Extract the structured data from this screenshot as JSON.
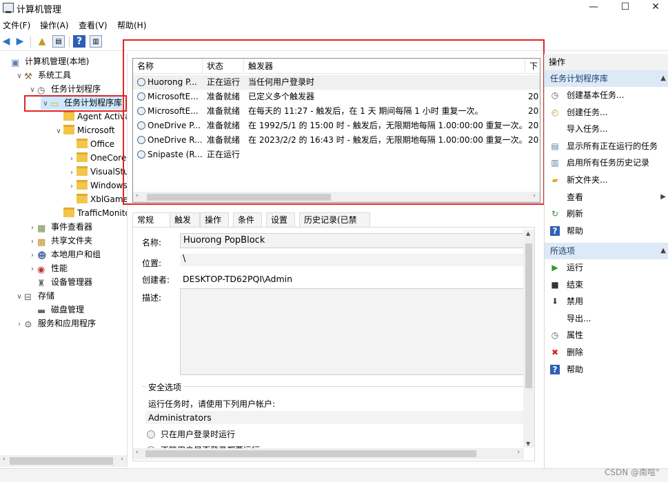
{
  "window": {
    "title": "计算机管理",
    "minimize": "—",
    "maximize": "☐",
    "close": "✕"
  },
  "menu": [
    "文件(F)",
    "操作(A)",
    "查看(V)",
    "帮助(H)"
  ],
  "tree": [
    {
      "label": "计算机管理(本地)",
      "level": 0,
      "chev": "",
      "icon": "computer-icon"
    },
    {
      "label": "系统工具",
      "level": 1,
      "chev": "∨",
      "icon": "tools-icon"
    },
    {
      "label": "任务计划程序",
      "level": 2,
      "chev": "∨",
      "icon": "clock-icon"
    },
    {
      "label": "任务计划程序库",
      "level": 3,
      "chev": "∨",
      "icon": "folder-clock-icon"
    },
    {
      "label": "Agent Activatio",
      "level": 4,
      "chev": "",
      "icon": "folder-icon"
    },
    {
      "label": "Microsoft",
      "level": 4,
      "chev": "∨",
      "icon": "folder-icon"
    },
    {
      "label": "Office",
      "level": 5,
      "chev": "",
      "icon": "folder-icon"
    },
    {
      "label": "OneCore",
      "level": 5,
      "chev": "›",
      "icon": "folder-icon"
    },
    {
      "label": "VisualStudio",
      "level": 5,
      "chev": "›",
      "icon": "folder-icon"
    },
    {
      "label": "Windows",
      "level": 5,
      "chev": "›",
      "icon": "folder-icon"
    },
    {
      "label": "XblGameSa",
      "level": 5,
      "chev": "",
      "icon": "folder-icon"
    },
    {
      "label": "TrafficMonitor",
      "level": 4,
      "chev": "",
      "icon": "folder-icon"
    },
    {
      "label": "事件查看器",
      "level": 2,
      "chev": "›",
      "icon": "event-viewer-icon"
    },
    {
      "label": "共享文件夹",
      "level": 2,
      "chev": "›",
      "icon": "shared-folder-icon"
    },
    {
      "label": "本地用户和组",
      "level": 2,
      "chev": "›",
      "icon": "users-icon"
    },
    {
      "label": "性能",
      "level": 2,
      "chev": "›",
      "icon": "performance-icon"
    },
    {
      "label": "设备管理器",
      "level": 2,
      "chev": "",
      "icon": "device-manager-icon"
    },
    {
      "label": "存储",
      "level": 1,
      "chev": "∨",
      "icon": "storage-icon"
    },
    {
      "label": "磁盘管理",
      "level": 2,
      "chev": "",
      "icon": "disk-icon"
    },
    {
      "label": "服务和应用程序",
      "level": 1,
      "chev": "›",
      "icon": "services-icon"
    }
  ],
  "list": {
    "headers": {
      "name": "名称",
      "status": "状态",
      "trigger": "触发器",
      "next": "下"
    },
    "rows": [
      {
        "name": "Huorong P...",
        "status": "正在运行",
        "trigger": "当任何用户登录时",
        "next": ""
      },
      {
        "name": "MicrosoftE...",
        "status": "准备就绪",
        "trigger": "已定义多个触发器",
        "next": "20"
      },
      {
        "name": "MicrosoftE...",
        "status": "准备就绪",
        "trigger": "在每天的 11:27 - 触发后，在 1 天 期间每隔 1 小时 重复一次。",
        "next": "20"
      },
      {
        "name": "OneDrive P...",
        "status": "准备就绪",
        "trigger": "在 1992/5/1 的 15:00 时 - 触发后，无限期地每隔 1.00:00:00 重复一次。",
        "next": "20"
      },
      {
        "name": "OneDrive R...",
        "status": "准备就绪",
        "trigger": "在 2023/2/2 的 16:43 时 - 触发后，无限期地每隔 1.00:00:00 重复一次。",
        "next": "20"
      },
      {
        "name": "Snipaste (R...",
        "status": "正在运行",
        "trigger": "",
        "next": ""
      }
    ]
  },
  "tabs": [
    "常规",
    "触发器",
    "操作",
    "条件",
    "设置",
    "历史记录(已禁用)"
  ],
  "general": {
    "name_label": "名称:",
    "name_value": "Huorong PopBlock",
    "location_label": "位置:",
    "location_value": "\\",
    "author_label": "创建者:",
    "author_value": "DESKTOP-TD62PQI\\Admin",
    "desc_label": "描述:",
    "security_title": "安全选项",
    "run_as_text": "运行任务时，请使用下列用户帐户:",
    "account": "Administrators",
    "radio1": "只在用户登录时运行",
    "radio2": "不管用户是否登录都要运行"
  },
  "actions": {
    "header": "操作",
    "section1": "任务计划程序库",
    "items1": [
      {
        "label": "创建基本任务...",
        "icon": "create-basic-task-icon"
      },
      {
        "label": "创建任务...",
        "icon": "create-task-icon"
      },
      {
        "label": "导入任务...",
        "icon": ""
      },
      {
        "label": "显示所有正在运行的任务",
        "icon": "running-tasks-icon"
      },
      {
        "label": "启用所有任务历史记录",
        "icon": "history-icon"
      },
      {
        "label": "新文件夹...",
        "icon": "new-folder-icon"
      },
      {
        "label": "查看",
        "icon": ""
      },
      {
        "label": "刷新",
        "icon": "refresh-icon"
      },
      {
        "label": "帮助",
        "icon": "help-icon"
      }
    ],
    "section2": "所选项",
    "items2": [
      {
        "label": "运行",
        "icon": "run-icon"
      },
      {
        "label": "结束",
        "icon": "end-icon"
      },
      {
        "label": "禁用",
        "icon": "disable-icon"
      },
      {
        "label": "导出...",
        "icon": ""
      },
      {
        "label": "属性",
        "icon": "properties-icon"
      },
      {
        "label": "删除",
        "icon": "delete-icon"
      },
      {
        "label": "帮助",
        "icon": "help-icon"
      }
    ]
  },
  "watermark": "CSDN @南喧°"
}
